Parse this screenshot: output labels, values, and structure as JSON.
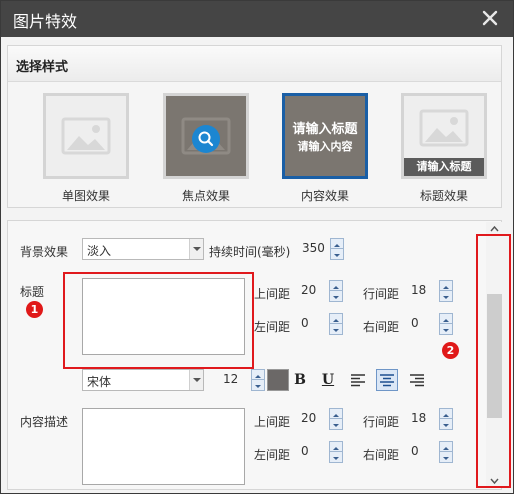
{
  "dialog": {
    "title": "图片特效",
    "close_icon": "close-icon"
  },
  "style_panel": {
    "header": "选择样式",
    "items": [
      {
        "label": "单图效果",
        "selected": false,
        "preview": "image-placeholder"
      },
      {
        "label": "焦点效果",
        "selected": false,
        "preview": "magnify-icon"
      },
      {
        "label": "内容效果",
        "selected": true,
        "overlay_title": "请输入标题",
        "overlay_body": "请输入内容"
      },
      {
        "label": "标题效果",
        "selected": false,
        "overlay_bar": "请输入标题"
      }
    ]
  },
  "settings": {
    "background_effect_label": "背景效果",
    "background_effect_value": "淡入",
    "duration_label": "持续时间(毫秒)",
    "duration_value": "350",
    "title_label": "标题",
    "title_text": "",
    "title_spacing": {
      "top_label": "上间距",
      "top_value": "20",
      "line_label": "行间距",
      "line_value": "18",
      "left_label": "左间距",
      "left_value": "0",
      "right_label": "右间距",
      "right_value": "0"
    },
    "font": {
      "family_value": "宋体",
      "size_value": "12",
      "color": "#6b6867",
      "bold": "B",
      "underline": "U",
      "align_active": "center"
    },
    "desc_label": "内容描述",
    "desc_text": "",
    "desc_spacing": {
      "top_label": "上间距",
      "top_value": "20",
      "line_label": "行间距",
      "line_value": "18",
      "left_label": "左间距",
      "left_value": "0",
      "right_label": "右间距",
      "right_value": "0"
    }
  },
  "annotations": {
    "marker_1": "1",
    "marker_2": "2"
  },
  "colors": {
    "titlebar": "#454545",
    "selected_border": "#1a5fa6",
    "annotation_red": "#e0191d",
    "spin_blue": "#e6eef8"
  }
}
